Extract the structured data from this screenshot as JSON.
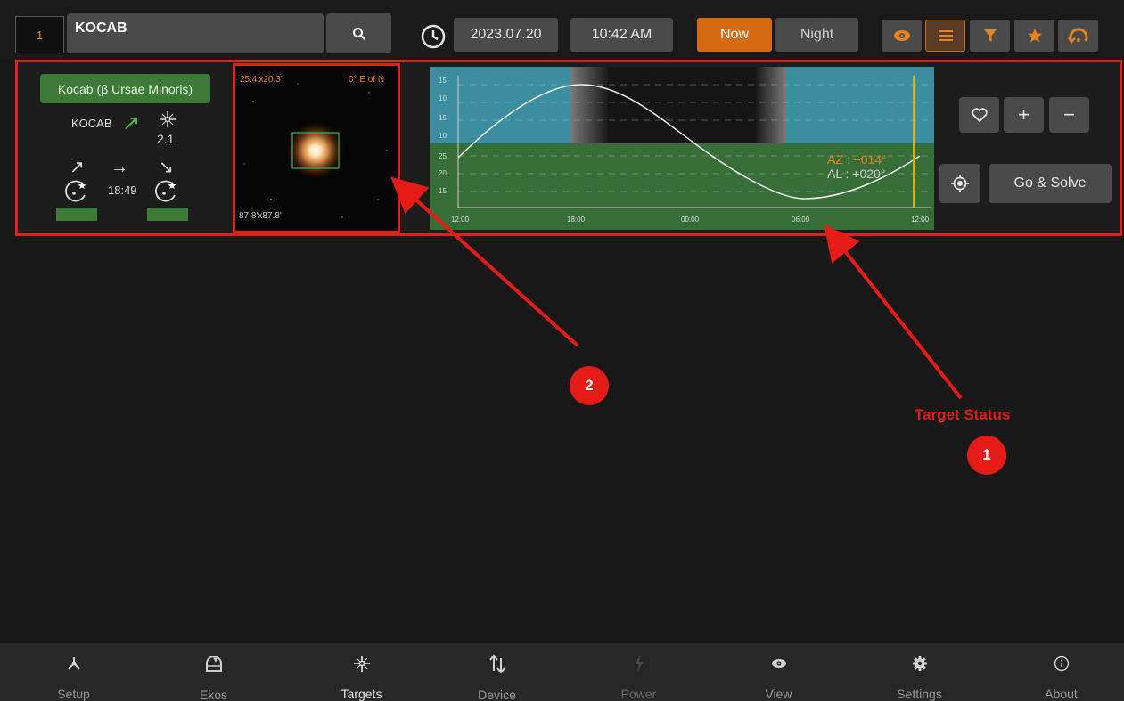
{
  "topbar": {
    "index": "1",
    "search_value": "KOCAB",
    "date": "2023.07.20",
    "time": "10:42 AM",
    "now_label": "Now",
    "night_label": "Night",
    "tools": [
      "eye-icon",
      "list-icon",
      "filter-icon",
      "star-icon",
      "refresh-icon"
    ],
    "accent": "#d46a12"
  },
  "target_status": {
    "name_button": "Kocab (β Ursae Minoris)",
    "catalog_name": "KOCAB",
    "magnitude": "2.1",
    "transit_time": "18:49",
    "fov_label": "25.4'x20.3'",
    "pa_label": "0° E of N",
    "fov2_label": "87.8'x87.8'",
    "azimuth": "AZ : +014°",
    "altitude": "AL : +020°",
    "go_solve_label": "Go & Solve"
  },
  "chart_data": {
    "type": "line",
    "x_ticks": [
      "12:00",
      "18:00",
      "00:00",
      "06:00",
      "12:00"
    ],
    "y_ticks": [
      "15",
      "10",
      "15",
      "10",
      "25",
      "20",
      "15"
    ]
  },
  "annotations": {
    "badge_1": "1",
    "badge_2": "2",
    "target_status_text": "Target Status",
    "color": "#e41b17"
  },
  "nav": [
    {
      "label": "Setup"
    },
    {
      "label": "Ekos"
    },
    {
      "label": "Targets"
    },
    {
      "label": "Device"
    },
    {
      "label": "Power"
    },
    {
      "label": "View"
    },
    {
      "label": "Settings"
    },
    {
      "label": "About"
    }
  ]
}
